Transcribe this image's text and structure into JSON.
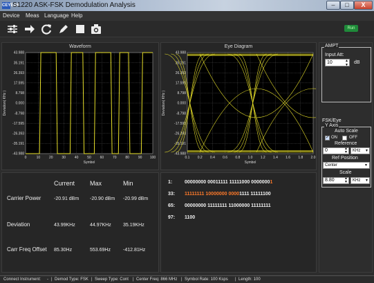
{
  "window": {
    "title": "S1220 ASK-FSK Demodulation Analysis",
    "icon_text": "CEYEAR",
    "controls": {
      "minimize": "–",
      "maximize": "□",
      "close": "X"
    }
  },
  "menu": [
    "Device",
    "Meas",
    "Language",
    "Help"
  ],
  "toolbar": {
    "icons": [
      "sliders-icon",
      "arrow-right-icon",
      "refresh-icon",
      "pen-icon",
      "stop-icon",
      "camera-icon"
    ],
    "status_badge": "Run"
  },
  "waveform": {
    "title": "Waveform",
    "ylabel": "Deviation( KHz )",
    "xlabel": "Symbol",
    "yticks": [
      "43.988",
      "35.191",
      "26.393",
      "17.595",
      "8.798",
      "0.000",
      "-8.798",
      "-17.595",
      "-26.393",
      "-35.191",
      "-43.988"
    ],
    "xticks": [
      "0",
      "10",
      "20",
      "30",
      "40",
      "50",
      "60",
      "70",
      "80",
      "90",
      "100"
    ]
  },
  "eye": {
    "title": "Eye Diagram",
    "ylabel": "Deviation( KHz )",
    "xlabel": "Symbol",
    "yticks": [
      "43.988",
      "35.191",
      "26.393",
      "17.595",
      "8.798",
      "0.000",
      "-8.798",
      "-17.595",
      "-26.393",
      "-35.191",
      "-43.988"
    ],
    "xticks": [
      "0.1",
      "0.2",
      "0.4",
      "0.6",
      "0.8",
      "1.0",
      "1.2",
      "1.4",
      "1.6",
      "1.8",
      "2.0"
    ]
  },
  "results": {
    "headers": [
      "Current",
      "Max",
      "Min"
    ],
    "rows": [
      {
        "label": "Carrier Power",
        "current": "-20.91 dBm",
        "max": "-20.90 dBm",
        "min": "-20.99 dBm"
      },
      {
        "label": "Deviation",
        "current": "43.99KHz",
        "max": "44.97KHz",
        "min": "35.19KHz"
      },
      {
        "label": "Carr Freq Offset",
        "current": "85.30Hz",
        "max": "553.69Hz",
        "min": "-412.81Hz"
      }
    ]
  },
  "bits": [
    {
      "index": "1:",
      "white": "00000000 00011111 11111000 0000000",
      "orange": "1",
      "rest": ""
    },
    {
      "index": "33:",
      "white": "",
      "orange": "11111111 10000000 0000",
      "rest": "1111 11111100"
    },
    {
      "index": "65:",
      "white": "00000000 11111111 11000000 11111111",
      "orange": "",
      "rest": ""
    },
    {
      "index": "97:",
      "white": "1100",
      "orange": "",
      "rest": ""
    }
  ],
  "ampt": {
    "group": "AMPT",
    "input_att_label": "Input Att:",
    "input_att_value": "10",
    "unit": "dB"
  },
  "fsk": {
    "title": "FSK/Eye",
    "yaxis_group": "Y Axis",
    "auto_scale_label": "Auto Scale",
    "on_label": "ON",
    "off_label": "OFF",
    "on_checked": true,
    "off_checked": false,
    "reference_label": "Reference",
    "reference_value": "0",
    "reference_unit": "KHz",
    "ref_position_label": "Ref Position",
    "ref_position_value": "Center",
    "scale_label": "Scale",
    "scale_value": "8.80",
    "scale_unit": "KHz"
  },
  "status": {
    "connect": "Connect Instrument:",
    "connect_value": "-",
    "demod": "Demod Type: FSK",
    "sweep": "Sweep Type: Cont",
    "center": "Center Freq: 866 MHz",
    "symrate": "Symbol Rate: 100 Ksps",
    "length": "Length: 100"
  },
  "colors": {
    "trace": "#e8e02a",
    "grid": "#8a8a8a",
    "orange_bits": "#ff7a2a",
    "run": "#1f8a3a"
  },
  "chart_data": [
    {
      "type": "line",
      "title": "Waveform",
      "xlabel": "Symbol",
      "ylabel": "Deviation( KHz )",
      "xlim": [
        0,
        100
      ],
      "ylim": [
        -43.988,
        43.988
      ],
      "grid": true,
      "series": [
        {
          "x": [
            0,
            11,
            12,
            24,
            25,
            35,
            36,
            45,
            46,
            54,
            55,
            67,
            68,
            73,
            74,
            81,
            82,
            91,
            92,
            100
          ],
          "values": [
            -43.988,
            -43.988,
            43.988,
            43.988,
            -43.988,
            -43.988,
            43.988,
            43.988,
            -43.988,
            -43.988,
            43.988,
            43.988,
            -43.988,
            -43.988,
            43.988,
            43.988,
            -43.988,
            -43.988,
            43.988,
            43.988
          ]
        }
      ]
    },
    {
      "type": "line",
      "title": "Eye Diagram",
      "xlabel": "Symbol",
      "ylabel": "Deviation( KHz )",
      "xlim": [
        0.0,
        2.0
      ],
      "ylim": [
        -43.988,
        43.988
      ],
      "grid": true
    }
  ]
}
